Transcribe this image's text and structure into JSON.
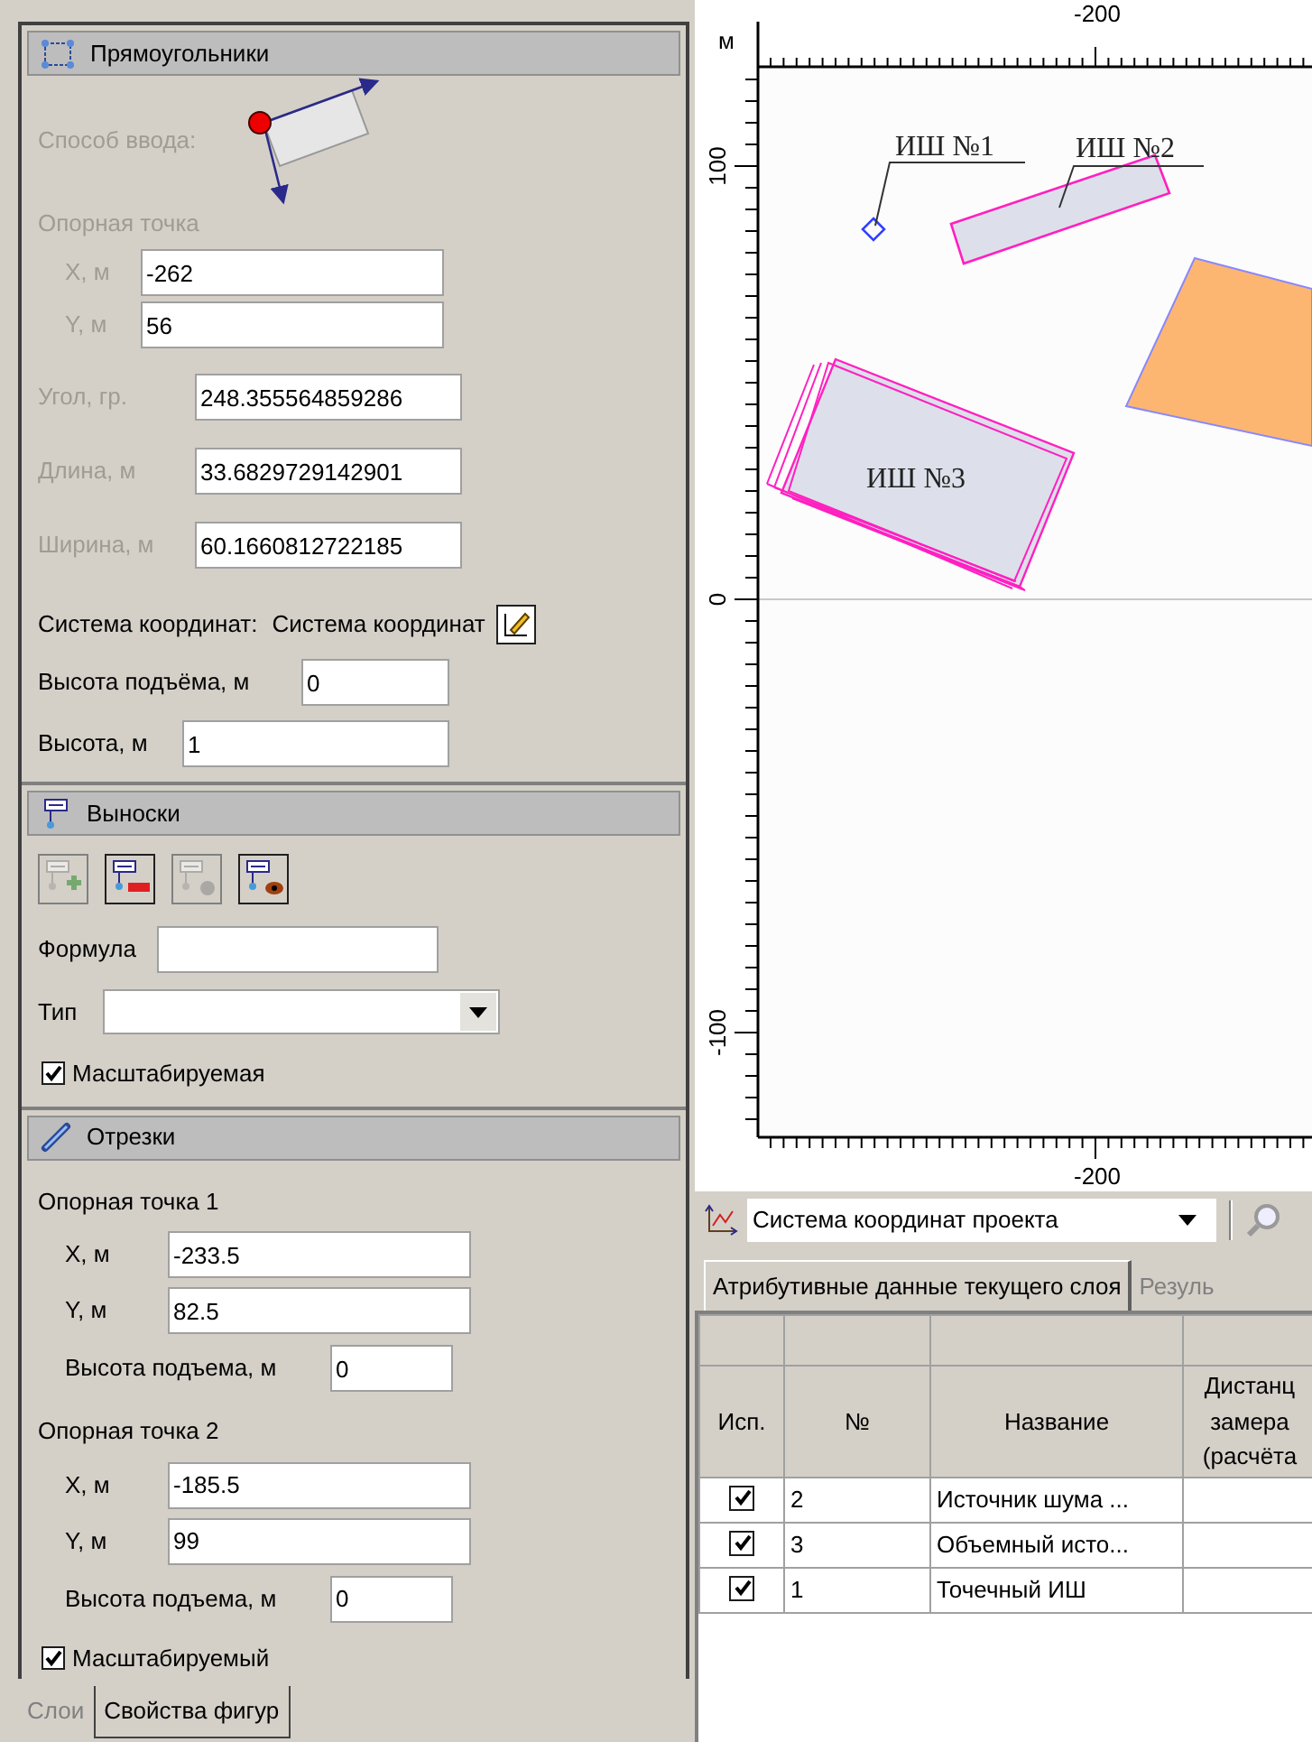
{
  "shape_properties": {
    "rectangles": {
      "title": "Прямоугольники",
      "input_method": {
        "label": "Способ ввода:",
        "disabled": true
      },
      "reference_point": {
        "label": "Опорная точка",
        "disabled": true,
        "fields": [
          {
            "label": "X, м",
            "value": "-262",
            "disabled": true
          },
          {
            "label": "Y, м",
            "value": "56",
            "disabled": true
          }
        ]
      },
      "params": [
        {
          "label": "Угол, гр.",
          "value": "248.355564859286",
          "disabled": true
        },
        {
          "label": "Длина, м",
          "value": "33.6829729142901",
          "disabled": true
        },
        {
          "label": "Ширина, м",
          "value": "60.1660812722185",
          "disabled": true
        }
      ],
      "coordinate_system": {
        "label": "Система координат:",
        "value": "Система координат"
      },
      "lift_height": {
        "label": "Высота подъёма, м",
        "value": "0"
      },
      "height": {
        "label": "Высота, м",
        "value": "1"
      }
    },
    "callouts": {
      "title": "Выноски",
      "tools": [
        {
          "kind": "add",
          "disabled": true
        },
        {
          "kind": "delete",
          "disabled": false
        },
        {
          "kind": "hide",
          "disabled": true
        },
        {
          "kind": "show",
          "disabled": false
        }
      ],
      "formula": {
        "label": "Формула"
      },
      "type": {
        "label": "Тип"
      },
      "scalable": {
        "label": "Масштабируемая",
        "checked": true
      }
    },
    "segments": {
      "title": "Отрезки",
      "points": [
        {
          "label": "Опорная точка 1",
          "fields": [
            {
              "label": "X, м",
              "value": "-233.5"
            },
            {
              "label": "Y, м",
              "value": "82.5"
            }
          ],
          "lift": {
            "label": "Высота подъема, м",
            "value": "0"
          }
        },
        {
          "label": "Опорная точка 2",
          "fields": [
            {
              "label": "X, м",
              "value": "-185.5"
            },
            {
              "label": "Y, м",
              "value": "99"
            }
          ],
          "lift": {
            "label": "Высота подъема, м",
            "value": "0"
          }
        }
      ],
      "scalable": {
        "label": "Масштабируемый",
        "checked": true
      }
    },
    "bottom_tabs": [
      {
        "label": "Слои",
        "selected": false
      },
      {
        "label": "Свойства фигур",
        "selected": true
      }
    ]
  },
  "map": {
    "unit": "м",
    "top_ruler": "-200",
    "left_ruler": [
      "100",
      "0",
      "-100"
    ],
    "bottom_ruler": "-200",
    "labels": [
      "ИШ №1",
      "ИШ №2",
      "ИШ №3"
    ]
  },
  "toolbar": {
    "coordinate_system": "Система координат проекта"
  },
  "data_tabs": [
    {
      "label": "Атрибутивные данные текущего слоя",
      "selected": true
    },
    {
      "label": "Резуль",
      "selected": false
    }
  ],
  "table": {
    "columns": [
      "Исп.",
      "№",
      "Название",
      "Дистанц замера (расчёта"
    ],
    "rows": [
      {
        "used": true,
        "number": "2",
        "name": "Источник шума ..."
      },
      {
        "used": true,
        "number": "3",
        "name": "Объемный исто..."
      },
      {
        "used": true,
        "number": "1",
        "name": "Точечный ИШ"
      }
    ]
  }
}
